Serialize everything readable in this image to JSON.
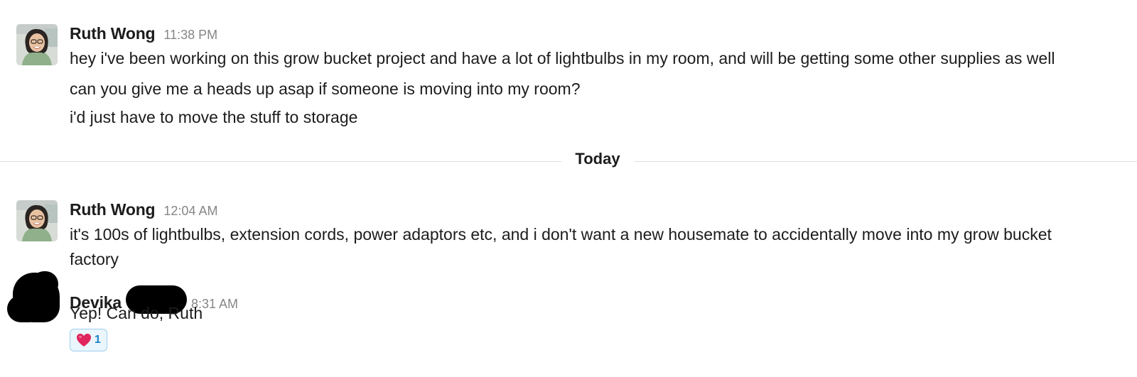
{
  "messages": [
    {
      "sender": "Ruth Wong",
      "time": "11:38 PM",
      "lines": [
        "hey i've been working on this grow bucket project and have a lot of lightbulbs in my room, and will be getting some other supplies as well",
        "can you give me a heads up asap if someone is moving into my room?",
        "i'd just have to move the stuff to storage"
      ]
    },
    {
      "sender": "Ruth Wong",
      "time": "12:04 AM",
      "lines": [
        "it's 100s of lightbulbs, extension cords, power adaptors etc, and i don't want a new housemate to accidentally move into my grow bucket",
        "factory"
      ]
    },
    {
      "sender": "Devika",
      "time": "8:31 AM",
      "lines": [
        "Yep! Can do, Ruth"
      ],
      "reaction": {
        "icon": "heart-emoji",
        "count": "1"
      }
    }
  ],
  "divider": {
    "label": "Today"
  },
  "colors": {
    "text": "#1d1c1d",
    "timestamp": "#868686",
    "divider": "#dddddd",
    "reaction_border": "#9ed0f0",
    "reaction_bg": "#eaf5fc",
    "reaction_count": "#1d82c5",
    "heart": "#e0245e"
  }
}
